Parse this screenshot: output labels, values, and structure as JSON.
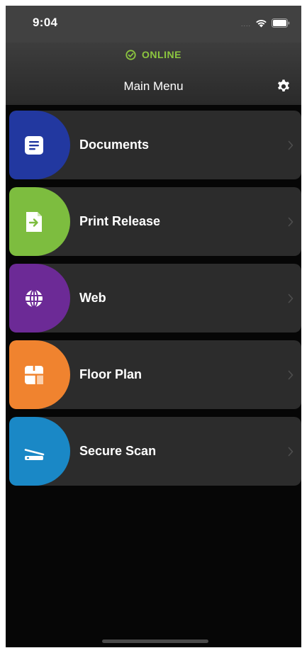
{
  "status_bar": {
    "time": "9:04",
    "signal": "....",
    "icons": [
      "wifi-icon",
      "battery-icon"
    ]
  },
  "header": {
    "status_text": "ONLINE",
    "status_color": "#8cc63f",
    "title": "Main Menu",
    "settings_icon": "gear-icon"
  },
  "menu": {
    "items": [
      {
        "label": "Documents",
        "color": "#2238a0",
        "icon": "document-icon"
      },
      {
        "label": "Print Release",
        "color": "#7dbd3f",
        "icon": "print-release-icon"
      },
      {
        "label": "Web",
        "color": "#6c2a96",
        "icon": "globe-icon"
      },
      {
        "label": "Floor Plan",
        "color": "#f0832f",
        "icon": "floor-plan-icon"
      },
      {
        "label": "Secure Scan",
        "color": "#1a88c6",
        "icon": "scanner-icon"
      }
    ]
  },
  "colors": {
    "background": "#060606",
    "card": "#2c2c2c",
    "header": "#414141"
  }
}
